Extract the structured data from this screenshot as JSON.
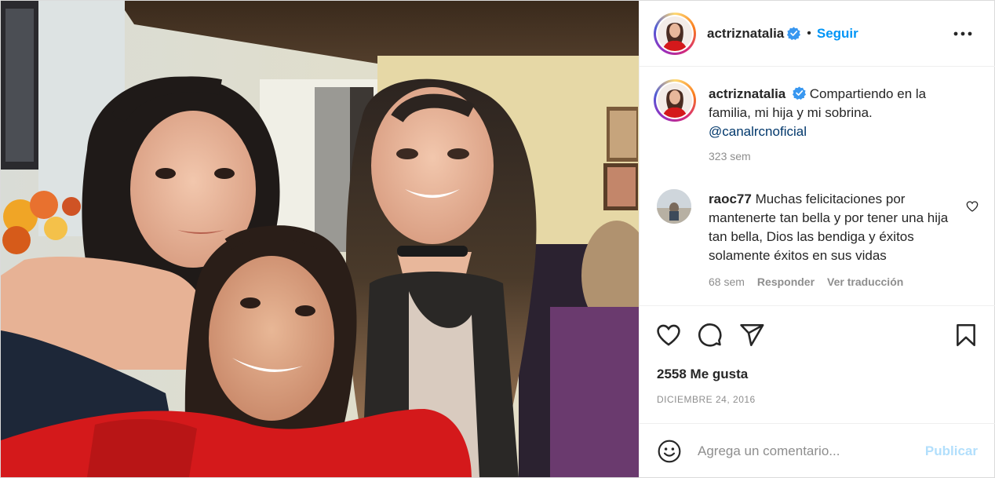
{
  "post": {
    "photo": {
      "icon": "selfie-photo"
    },
    "header": {
      "username": "actriznatalia",
      "verified_icon": "verified-badge-icon",
      "separator": "•",
      "follow_label": "Seguir",
      "more_icon": "more-options-icon"
    },
    "caption": {
      "username": "actriznatalia",
      "text": "Compartiendo en la familia, mi hija y mi sobrina.",
      "mention": "@canalrcnoficial",
      "time": "323 sem"
    },
    "comments": [
      {
        "username": "raoc77",
        "text": "Muchas felicitaciones por mantenerte tan bella y por tener una hija tan bella, Dios las bendiga y éxitos solamente éxitos en sus vidas",
        "time": "68 sem",
        "reply_label": "Responder",
        "translate_label": "Ver traducción"
      }
    ],
    "actions": {
      "like_icon": "heart-icon",
      "comment_icon": "comment-icon",
      "share_icon": "share-icon",
      "save_icon": "bookmark-icon",
      "likes": "2558 Me gusta",
      "date": "DICIEMBRE 24, 2016"
    },
    "add_comment": {
      "emoji_icon": "emoji-icon",
      "placeholder": "Agrega un comentario...",
      "publish_label": "Publicar"
    },
    "colors": {
      "link_blue": "#0095f6",
      "mention_blue": "#00376b",
      "publish_disabled": "#b2dffc",
      "muted_text": "#8e8e8e",
      "border": "#efefef"
    }
  }
}
